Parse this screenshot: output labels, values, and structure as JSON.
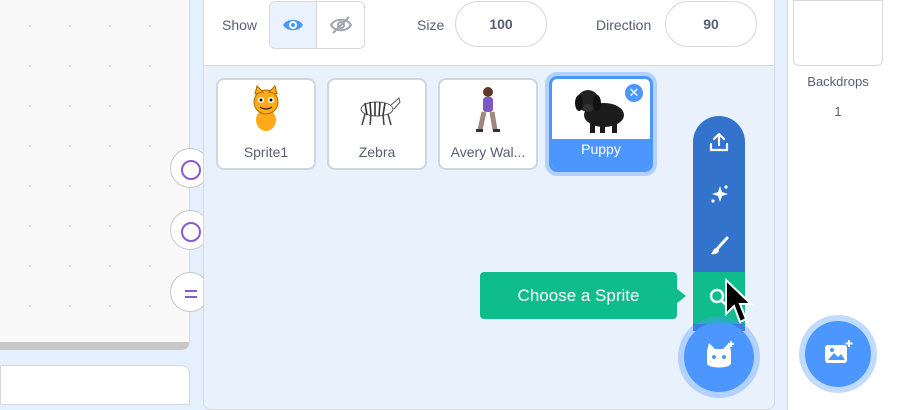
{
  "sprite_info": {
    "show_label": "Show",
    "size_label": "Size",
    "size_value": "100",
    "direction_label": "Direction",
    "direction_value": "90"
  },
  "sprites": [
    {
      "name": "Sprite1",
      "icon": "cat-sprite-icon",
      "selected": false
    },
    {
      "name": "Zebra",
      "icon": "zebra-sprite-icon",
      "selected": false
    },
    {
      "name": "Avery Wal...",
      "icon": "avery-walking-sprite-icon",
      "selected": false
    },
    {
      "name": "Puppy",
      "icon": "puppy-sprite-icon",
      "selected": true
    }
  ],
  "sprite_menu": {
    "items": [
      "upload-icon",
      "surprise-icon",
      "paint-icon",
      "search-icon"
    ],
    "tooltip": "Choose a Sprite"
  },
  "stage": {
    "backdrops_label": "Backdrops",
    "backdrops_count": "1"
  },
  "colors": {
    "accent": "#4c97ff",
    "menu_dark": "#3373cc",
    "active_green": "#0fbd8c",
    "pane_bg": "#e9f1fc"
  }
}
